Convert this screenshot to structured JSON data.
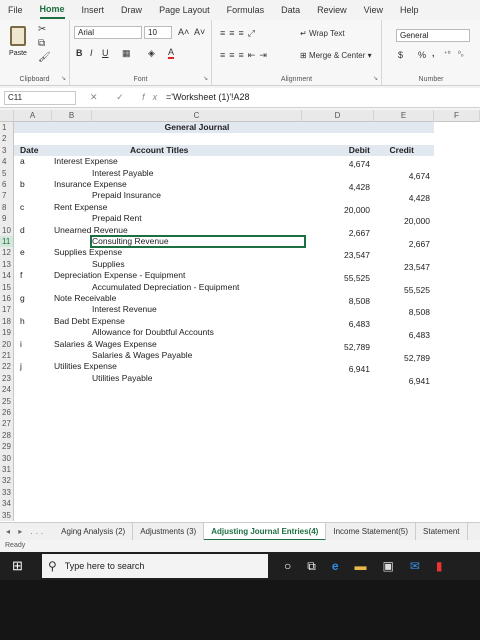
{
  "menu": {
    "tabs": [
      "File",
      "Home",
      "Insert",
      "Draw",
      "Page Layout",
      "Formulas",
      "Data",
      "Review",
      "View",
      "Help"
    ],
    "active": "Home"
  },
  "ribbon": {
    "clipboard_label": "Clipboard",
    "paste_label": "Paste",
    "font_label": "Font",
    "font_name": "Arial",
    "font_size": "10",
    "bold": "B",
    "italic": "I",
    "underline": "U",
    "grow": "A˄",
    "shrink": "A˅",
    "alignment_label": "Alignment",
    "wrap_text": "Wrap Text",
    "merge_center": "Merge & Center",
    "number_label": "Number",
    "number_format": "General",
    "currency": "$",
    "percent": "%",
    "comma": "‚"
  },
  "formula_bar": {
    "name_box": "C11",
    "fx": "fx",
    "content": "='Worksheet (1)'!A28"
  },
  "columns": [
    "A",
    "B",
    "C",
    "D",
    "E",
    "F"
  ],
  "sheet": {
    "title": "General Journal",
    "headers": {
      "date": "Date",
      "account": "Account Titles",
      "debit": "Debit",
      "credit": "Credit"
    },
    "rows": [
      {
        "n": "1",
        "a": "",
        "b": "",
        "indent": false,
        "text": "",
        "debit": "",
        "credit": ""
      },
      {
        "n": "2",
        "a": "",
        "b": "",
        "indent": false,
        "text": "",
        "debit": "",
        "credit": ""
      },
      {
        "n": "3",
        "a": "",
        "b": "",
        "indent": false,
        "text": "",
        "debit": "",
        "credit": ""
      },
      {
        "n": "4",
        "a": "a",
        "b": "",
        "indent": false,
        "text": "Interest Expense",
        "debit": "4,674",
        "credit": ""
      },
      {
        "n": "5",
        "a": "",
        "b": "",
        "indent": true,
        "text": "Interest Payable",
        "debit": "",
        "credit": "4,674"
      },
      {
        "n": "6",
        "a": "b",
        "b": "",
        "indent": false,
        "text": "Insurance Expense",
        "debit": "4,428",
        "credit": ""
      },
      {
        "n": "7",
        "a": "",
        "b": "",
        "indent": true,
        "text": "Prepaid Insurance",
        "debit": "",
        "credit": "4,428"
      },
      {
        "n": "8",
        "a": "c",
        "b": "",
        "indent": false,
        "text": "Rent Expense",
        "debit": "20,000",
        "credit": ""
      },
      {
        "n": "9",
        "a": "",
        "b": "",
        "indent": true,
        "text": "Prepaid Rent",
        "debit": "",
        "credit": "20,000"
      },
      {
        "n": "10",
        "a": "d",
        "b": "",
        "indent": false,
        "text": "Unearned Revenue",
        "debit": "2,667",
        "credit": ""
      },
      {
        "n": "11",
        "a": "",
        "b": "",
        "indent": true,
        "text": "Consulting Revenue",
        "debit": "",
        "credit": "2,667"
      },
      {
        "n": "12",
        "a": "e",
        "b": "",
        "indent": false,
        "text": "Supplies Expense",
        "debit": "23,547",
        "credit": ""
      },
      {
        "n": "13",
        "a": "",
        "b": "",
        "indent": true,
        "text": "Supplies",
        "debit": "",
        "credit": "23,547"
      },
      {
        "n": "14",
        "a": "f",
        "b": "",
        "indent": false,
        "text": "Depreciation Expense - Equipment",
        "debit": "55,525",
        "credit": ""
      },
      {
        "n": "15",
        "a": "",
        "b": "",
        "indent": true,
        "text": "Accumulated Depreciation - Equipment",
        "debit": "",
        "credit": "55,525"
      },
      {
        "n": "16",
        "a": "g",
        "b": "",
        "indent": false,
        "text": "Note Receivable",
        "debit": "8,508",
        "credit": ""
      },
      {
        "n": "17",
        "a": "",
        "b": "",
        "indent": true,
        "text": "Interest Revenue",
        "debit": "",
        "credit": "8,508"
      },
      {
        "n": "18",
        "a": "h",
        "b": "",
        "indent": false,
        "text": "Bad Debt Expense",
        "debit": "6,483",
        "credit": ""
      },
      {
        "n": "19",
        "a": "",
        "b": "",
        "indent": true,
        "text": "Allowance for Doubtful Accounts",
        "debit": "",
        "credit": "6,483"
      },
      {
        "n": "20",
        "a": "i",
        "b": "",
        "indent": false,
        "text": "Salaries & Wages Expense",
        "debit": "52,789",
        "credit": ""
      },
      {
        "n": "21",
        "a": "",
        "b": "",
        "indent": true,
        "text": "Salaries & Wages Payable",
        "debit": "",
        "credit": "52,789"
      },
      {
        "n": "22",
        "a": "j",
        "b": "",
        "indent": false,
        "text": "Utilities Expense",
        "debit": "6,941",
        "credit": ""
      },
      {
        "n": "23",
        "a": "",
        "b": "",
        "indent": true,
        "text": "Utilities Payable",
        "debit": "",
        "credit": "6,941"
      },
      {
        "n": "24",
        "a": "",
        "b": "",
        "indent": false,
        "text": "",
        "debit": "",
        "credit": ""
      },
      {
        "n": "25",
        "a": "",
        "b": "",
        "indent": false,
        "text": "",
        "debit": "",
        "credit": ""
      },
      {
        "n": "26",
        "a": "",
        "b": "",
        "indent": false,
        "text": "",
        "debit": "",
        "credit": ""
      },
      {
        "n": "27",
        "a": "",
        "b": "",
        "indent": false,
        "text": "",
        "debit": "",
        "credit": ""
      },
      {
        "n": "28",
        "a": "",
        "b": "",
        "indent": false,
        "text": "",
        "debit": "",
        "credit": ""
      },
      {
        "n": "29",
        "a": "",
        "b": "",
        "indent": false,
        "text": "",
        "debit": "",
        "credit": ""
      },
      {
        "n": "30",
        "a": "",
        "b": "",
        "indent": false,
        "text": "",
        "debit": "",
        "credit": ""
      },
      {
        "n": "31",
        "a": "",
        "b": "",
        "indent": false,
        "text": "",
        "debit": "",
        "credit": ""
      },
      {
        "n": "32",
        "a": "",
        "b": "",
        "indent": false,
        "text": "",
        "debit": "",
        "credit": ""
      },
      {
        "n": "33",
        "a": "",
        "b": "",
        "indent": false,
        "text": "",
        "debit": "",
        "credit": ""
      },
      {
        "n": "34",
        "a": "",
        "b": "",
        "indent": false,
        "text": "",
        "debit": "",
        "credit": ""
      },
      {
        "n": "35",
        "a": "",
        "b": "",
        "indent": false,
        "text": "",
        "debit": "",
        "credit": ""
      }
    ]
  },
  "sheet_tabs": {
    "nav": "◂ ▸ ...",
    "tabs": [
      "Aging Analysis (2)",
      "Adjustments (3)",
      "Adjusting Journal Entries(4)",
      "Income Statement(5)",
      "Statement"
    ],
    "active": "Adjusting Journal Entries(4)"
  },
  "status": "Ready",
  "taskbar": {
    "search_placeholder": "Type here to search"
  },
  "colors": {
    "accent": "#1d6f42",
    "header_band": "#e2e8f0"
  }
}
